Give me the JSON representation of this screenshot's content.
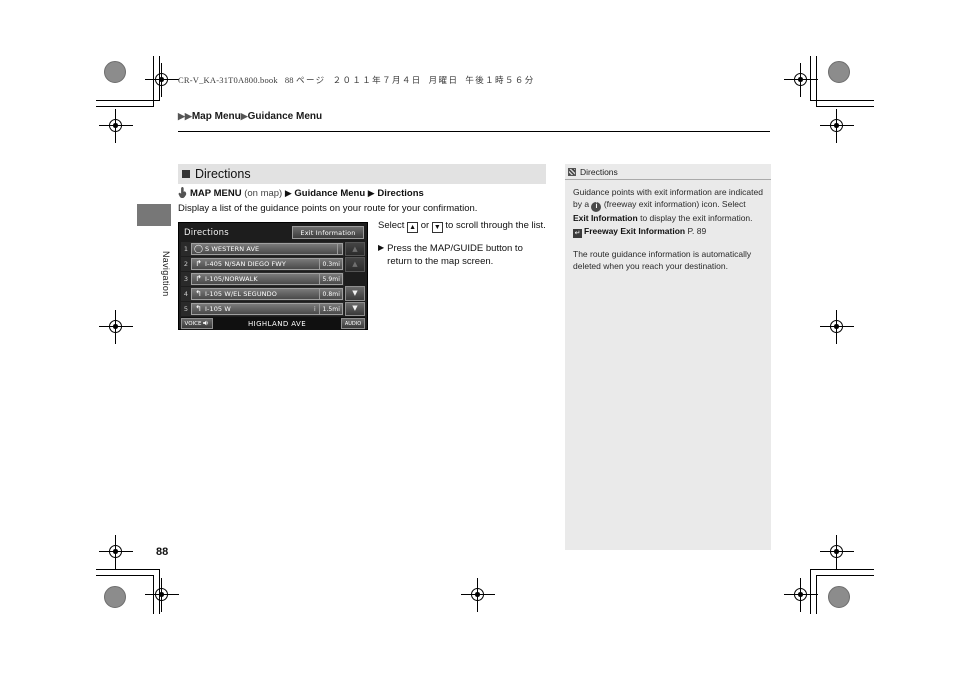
{
  "header": {
    "book_file": "CR-V_KA-31T0A800.book",
    "page_label": "88",
    "page_unit": "ページ",
    "date": "２０１１年７月４日",
    "weekday": "月曜日",
    "time": "午後１時５６分"
  },
  "breadcrumb": {
    "tri1": "▶",
    "tri2": "▶",
    "item1": "Map Menu",
    "tri3": "▶",
    "item2": "Guidance Menu"
  },
  "side_tab": {
    "label": "Navigation"
  },
  "section": {
    "title": "Directions",
    "menu_path": {
      "hand_icon": "hand-pointer-icon",
      "root": "MAP MENU",
      "root_suffix": "(on map)",
      "tri1": "▶",
      "step1": "Guidance Menu",
      "tri2": "▶",
      "step2": "Directions"
    },
    "lede": "Display a list of the guidance points on your route for your confirmation."
  },
  "nav_screen": {
    "title": "Directions",
    "exit_info_button": "Exit Information",
    "rows": [
      {
        "index": "1",
        "arrow": "start-circle-icon",
        "glyph": "◯",
        "name": "S WESTERN AVE",
        "info": "",
        "distance": ""
      },
      {
        "index": "2",
        "arrow": "turn-right-ramp-icon",
        "glyph": "↱",
        "name": "I-405 N/SAN DIEGO FWY",
        "info": "",
        "distance": "0.3mi"
      },
      {
        "index": "3",
        "arrow": "turn-right-icon",
        "glyph": "↱",
        "name": "I-105/NORWALK",
        "info": "",
        "distance": "5.9mi"
      },
      {
        "index": "4",
        "arrow": "turn-left-slight-icon",
        "glyph": "↰",
        "name": "I-105 W/EL SEGUNDO",
        "info": "",
        "distance": "0.8mi"
      },
      {
        "index": "5",
        "arrow": "turn-left-icon",
        "glyph": "↰",
        "name": "I-105 W",
        "info": "i",
        "distance": "1.5mi"
      }
    ],
    "scroll_buttons": [
      {
        "name": "scroll-top-button",
        "glyph": "▲",
        "state": "disabled"
      },
      {
        "name": "scroll-up-button",
        "glyph": "▲",
        "state": "disabled"
      },
      {
        "name": "scroll-down-button",
        "glyph": "▼",
        "state": "enabled"
      },
      {
        "name": "scroll-bottom-button",
        "glyph": "▼",
        "state": "enabled"
      }
    ],
    "bottom_bar": {
      "voice_label": "VOICE",
      "voice_icon": "speaker-icon",
      "street": "HIGHLAND AVE",
      "audio_label": "AUDIO"
    }
  },
  "instructions": {
    "line1_pre": "Select",
    "up_key": "▲",
    "line1_mid": "or",
    "down_key": "▼",
    "line1_post": "to scroll through the list.",
    "bullet_tri": "▶",
    "bullet_text": "Press the MAP/GUIDE button to return to the map screen."
  },
  "note": {
    "heading": "Directions",
    "heading_icon": "note-square-icon",
    "para1_a": "Guidance points with exit information are indicated by a",
    "info_icon": "i",
    "para1_b": "(freeway exit information) icon. Select",
    "para1_bold": "Exit Information",
    "para1_c": "to display the exit information.",
    "ref_icon": "cross-reference-icon",
    "ref_title": "Freeway Exit Information",
    "ref_page": "P. 89",
    "para2": "The route guidance information is automatically deleted when you reach your destination."
  },
  "footer": {
    "page_number": "88"
  }
}
